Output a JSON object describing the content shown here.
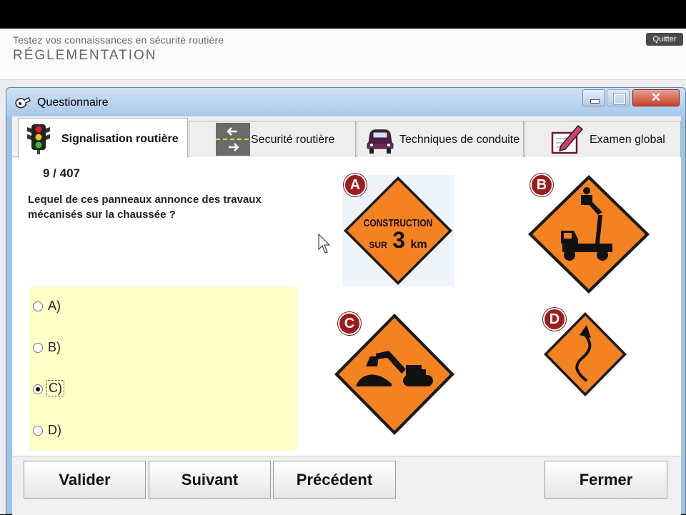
{
  "header": {
    "subtitle": "Testez vos connaissances en sécurité routière",
    "title": "RÉGLEMENTATION",
    "quit_label": "Quitter"
  },
  "window": {
    "title": "Questionnaire"
  },
  "tabs": [
    {
      "label": "Signalisation routière",
      "icon": "traffic-light-icon",
      "active": true
    },
    {
      "label": "Securité routière",
      "icon": "lane-arrows-icon",
      "active": false
    },
    {
      "label": "Techniques de conduite",
      "icon": "car-icon",
      "active": false
    },
    {
      "label": "Examen global",
      "icon": "exam-pencil-icon",
      "active": false
    }
  ],
  "quiz": {
    "counter": "9 / 407",
    "question": "Lequel de ces panneaux annonce des travaux mécanisés sur la chaussée ?",
    "answers": [
      {
        "label": "A)",
        "checked": false
      },
      {
        "label": "B)",
        "checked": false
      },
      {
        "label": "C)",
        "checked": true
      },
      {
        "label": "D)",
        "checked": false
      }
    ]
  },
  "signs": {
    "a": {
      "badge": "A",
      "line1": "CONSTRUCTION",
      "line2_small": "SUR",
      "line2_big": "3",
      "line2_unit": "km"
    },
    "b": {
      "badge": "B",
      "icon": "bucket-truck-icon"
    },
    "c": {
      "badge": "C",
      "icon": "excavator-icon"
    },
    "d": {
      "badge": "D",
      "icon": "winding-road-arrow-icon"
    }
  },
  "colors": {
    "sign_orange": "#f58220",
    "badge_red": "#9a1e1e",
    "answer_bg": "#ffffc8",
    "window_frame": "#9fc3e6"
  },
  "footer": {
    "validate_label": "Valider",
    "next_label": "Suivant",
    "previous_label": "Précédent",
    "close_label": "Fermer"
  }
}
